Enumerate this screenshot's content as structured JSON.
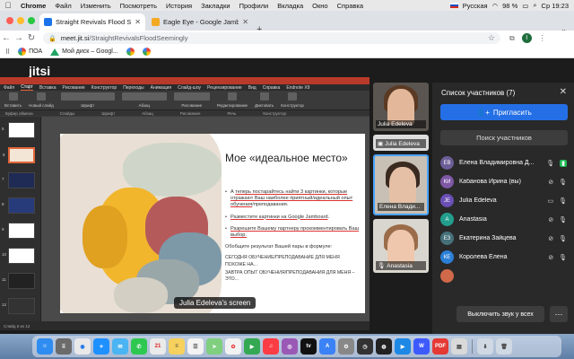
{
  "menubar": {
    "app": "Chrome",
    "items": [
      "Файл",
      "Изменить",
      "Посмотреть",
      "История",
      "Закладки",
      "Профили",
      "Вкладка",
      "Окно",
      "Справка"
    ],
    "keyboard": "Русская",
    "battery": "98 %",
    "clock": "Ср 19:23"
  },
  "tabs": [
    {
      "title": "Straight Revivals Flood Se...",
      "active": true
    },
    {
      "title": "Eagle Eye - Google Jamboard",
      "active": false
    }
  ],
  "address": {
    "host": "meet.jit.si",
    "path": "/StraightRevivalsFloodSeemingly",
    "profile_initial": "I"
  },
  "bookmarks": [
    "ПОА",
    "Мой диск – Googl..."
  ],
  "jitsi": {
    "logo": "jitsi",
    "screen_label": "Julia Edeleva's screen"
  },
  "powerpoint": {
    "menu": [
      "Файл",
      "Старт",
      "Вставка",
      "Рисование",
      "Конструктор",
      "Переходы",
      "Анимация",
      "Слайд-шоу",
      "Рецензирование",
      "Вид",
      "Справка",
      "Endnote X9"
    ],
    "active_menu": "Старт",
    "ribbon": [
      "Вставить",
      "Новый слайд",
      "Шрифт",
      "Абзац",
      "Рисование",
      "Редактирование",
      "Диктовать",
      "Конструктор"
    ],
    "groups": [
      "Буфер обмена",
      "Слайды",
      "Шрифт",
      "Абзац",
      "Рисование",
      "Речь",
      "Конструктор"
    ],
    "slide_numbers": [
      "5",
      "6",
      "7",
      "8",
      "9",
      "10",
      "11",
      "12"
    ],
    "selected_slide": "6",
    "status": "Слайд 6 из 12"
  },
  "slide": {
    "title": "Мое «идеальное место»",
    "bullet1_pre": "А ",
    "bullet1_link": "теперь постарайтесь найти 3 картинки, которые отражают Ваш наиболее приятный/идеальный опыт обучения",
    "bullet1_post": "/преподавания.",
    "bullet2_link": "Разместите картинки на Google Jamboard",
    "bullet2_post": ".",
    "bullet3_link": "Разрешите Вашему партнеру прокомментировать Ваш выбор.",
    "formula": "Обобщите результат Вашей пары в формуле:",
    "line1": "СЕГОДНЯ ОБУЧЕНИЕ/ПРЕПОДАВАНИЕ ДЛЯ МЕНЯ ПОХОЖЕ НА...",
    "line2": "ЗАВТРА ОПЫТ ОБУЧЕНИЯ/ПРЕПОДАВАНИЯ ДЛЯ МЕНЯ – ЭТО..."
  },
  "filmstrip": [
    {
      "name": "Julia Edeleva"
    },
    {
      "name": "Julia Edeleva"
    },
    {
      "name": "Елена Влади..."
    },
    {
      "name": "Anastasia"
    }
  ],
  "participants": {
    "header": "Список участников (7)",
    "invite": "Пригласить",
    "search": "Поиск участников",
    "list": [
      {
        "initials": "ЕВ",
        "name": "Елена Владимировна Д...",
        "color": "#6b5d96"
      },
      {
        "initials": "КИ",
        "name": "Кабанова Ирина (вы)",
        "color": "#7e57a5"
      },
      {
        "initials": "JE",
        "name": "Julia Edeleva",
        "color": "#6a4fb5"
      },
      {
        "initials": "A",
        "name": "Anastasia",
        "color": "#239e8e"
      },
      {
        "initials": "ЕЗ",
        "name": "Екатерина Зайцева",
        "color": "#46707a"
      },
      {
        "initials": "КЕ",
        "name": "Королева Елена",
        "color": "#2b7fd6"
      }
    ],
    "mute_all": "Выключить звук у всех",
    "more": "⋯"
  },
  "dock": {
    "calendar_day": "21",
    "pdf_label": "PDF"
  }
}
